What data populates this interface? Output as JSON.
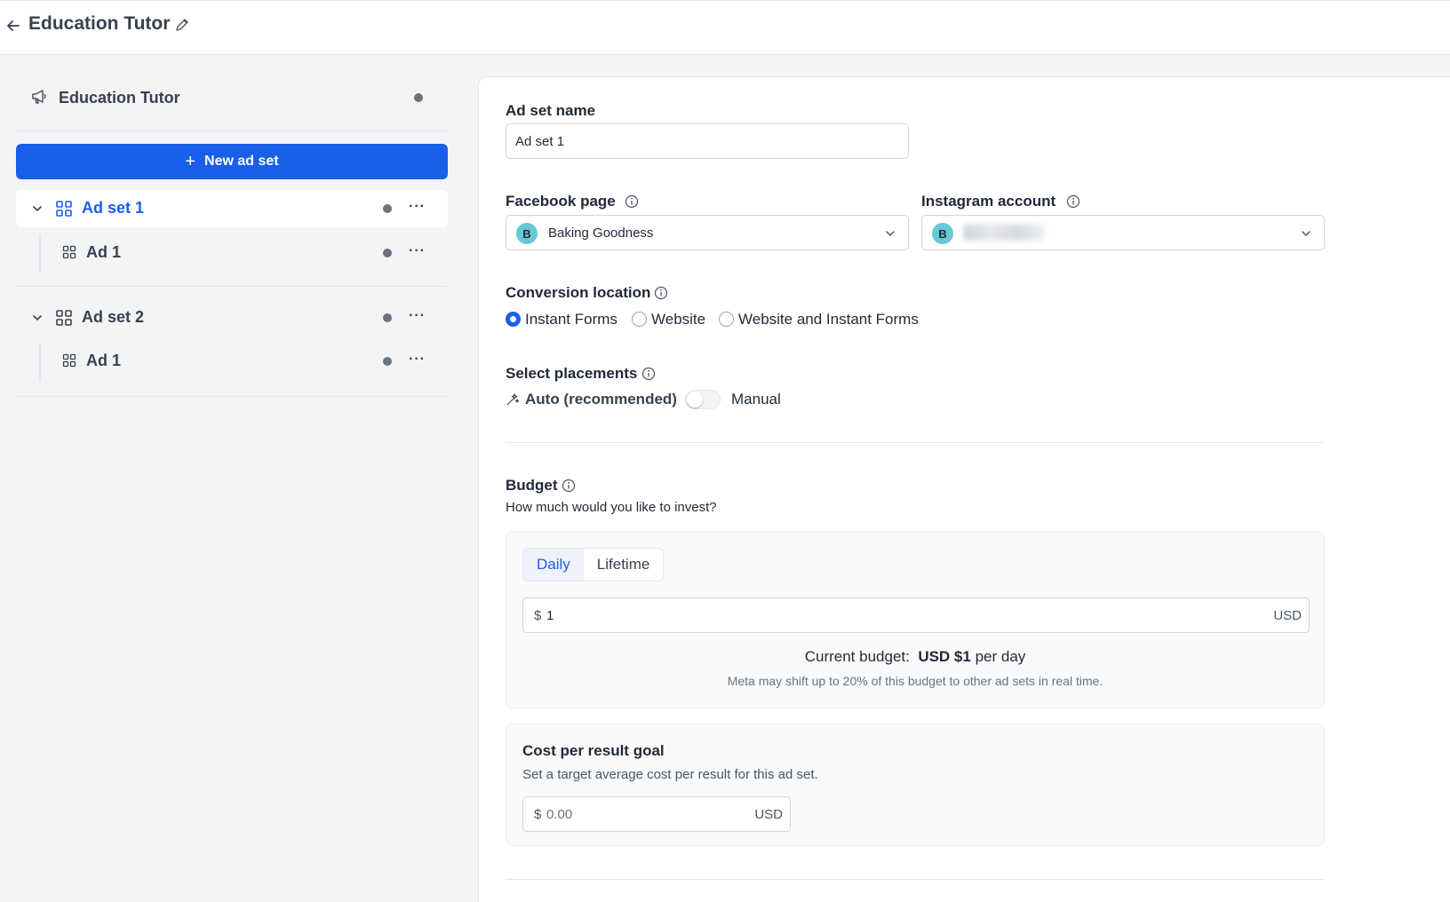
{
  "header": {
    "title": "Education Tutor"
  },
  "sidebar": {
    "campaign_name": "Education Tutor",
    "new_ad_set_label": "New ad set",
    "ad_sets": [
      {
        "label": "Ad set 1",
        "ads": [
          {
            "label": "Ad 1"
          }
        ]
      },
      {
        "label": "Ad set 2",
        "ads": [
          {
            "label": "Ad 1"
          }
        ]
      }
    ],
    "more_label": "···"
  },
  "form": {
    "ad_set_name_label": "Ad set name",
    "ad_set_name_value": "Ad set 1",
    "facebook_page_label": "Facebook page",
    "facebook_page_value": "Baking Goodness",
    "facebook_page_avatar": "B",
    "instagram_account_label": "Instagram account",
    "instagram_account_avatar": "B",
    "conversion_location_label": "Conversion location",
    "conversion_options": [
      "Instant Forms",
      "Website",
      "Website and Instant Forms"
    ],
    "conversion_selected": "Instant Forms",
    "placements_label": "Select placements",
    "placements_auto_label": "Auto (recommended)",
    "placements_manual_label": "Manual",
    "budget_label": "Budget",
    "budget_question": "How much would you like to invest?",
    "budget_tabs": [
      "Daily",
      "Lifetime"
    ],
    "budget_tab_selected": "Daily",
    "budget_currency_symbol": "$",
    "budget_value": "1",
    "budget_currency": "USD",
    "current_budget_prefix": "Current budget:",
    "current_budget_value": "USD $1",
    "current_budget_suffix": "per day",
    "budget_note": "Meta may shift up to 20% of this budget to other ad sets in real time.",
    "cost_goal_label": "Cost per result goal",
    "cost_goal_desc": "Set a target average cost per result for this ad set.",
    "cost_goal_currency_symbol": "$",
    "cost_goal_placeholder": "0.00",
    "cost_goal_currency": "USD"
  },
  "colors": {
    "primary": "#1a5fe8",
    "avatar": "#67c8d6",
    "status_dot": "#6b7280"
  }
}
